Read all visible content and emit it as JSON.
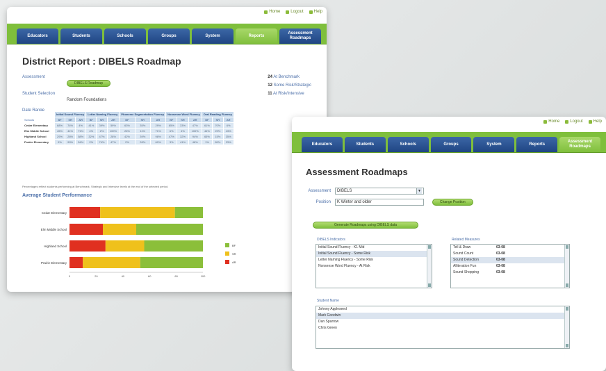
{
  "win1": {
    "toplinks": [
      "Home",
      "Logout",
      "Help"
    ],
    "tabs": [
      "Educators",
      "Students",
      "Schools",
      "Groups",
      "System",
      "Reports",
      "Assessment Roadmaps"
    ],
    "active_tab": 5,
    "title": "District Report : DIBELS Roadmap",
    "info": [
      {
        "label": "Assessment",
        "value": "DIBELS Roadmap",
        "pill": true
      },
      {
        "label": "Student Selection",
        "value": "Random Foundations",
        "pill": false
      },
      {
        "label": "Date Range",
        "value": "",
        "pill": false
      }
    ],
    "links": [
      {
        "count": "24",
        "text": "At Benchmark"
      },
      {
        "count": "12",
        "text": "Some Risk/Strategic"
      },
      {
        "count": "11",
        "text": "At Risk/Intensive"
      }
    ],
    "table": {
      "groups": [
        "Initial Sound Fluency",
        "Letter Naming Fluency",
        "Phoneme Segmentation Fluency",
        "Nonsense Word Fluency",
        "Oral Reading Fluency"
      ],
      "subheaders": [
        "BF",
        "SR",
        "AR"
      ],
      "first_col": "Schools",
      "rows": [
        {
          "name": "Cedar Elementary",
          "cells": [
            "68%",
            "74%",
            "4%",
            "41%",
            "39%",
            "59%",
            "63%",
            "35%",
            "29%",
            "65%",
            "33%",
            "47%",
            "61%",
            "70%",
            "6%"
          ]
        },
        {
          "name": "Elm Middle School",
          "cells": [
            "45%",
            "41%",
            "71%",
            "4%",
            "2%",
            "100%",
            "26%",
            "11%",
            "71%",
            "6%",
            "4%",
            "100%",
            "44%",
            "29%",
            "43%"
          ]
        },
        {
          "name": "Highland School",
          "cells": "29% 28% 58% 32% 47% 28% 42% 39% 98% 47% 32% 94% 65% 15% 35%"
        },
        {
          "name": "Prairie Elementary",
          "cells": "9% 99% 54% 2% 74% 47% 2% 28% 60% 3% 41% 48% 1% 89% 23%"
        }
      ]
    },
    "footnote": "Percentages reflect students performing at Benchmark, Strategic and Intensive levels at the end of the selected period.",
    "perf_title": "Average Student Performance"
  },
  "chart_data": {
    "type": "bar",
    "orientation": "horizontal",
    "stacked": true,
    "categories": [
      "Cedar Elementary",
      "Elm Middle School",
      "Highland School",
      "Prairie Elementary"
    ],
    "series": [
      {
        "name": "AR",
        "color": "#e03020",
        "values": [
          23,
          25,
          27,
          10
        ]
      },
      {
        "name": "SR",
        "color": "#efc11c",
        "values": [
          56,
          25,
          29,
          43
        ]
      },
      {
        "name": "BF",
        "color": "#8bbf3a",
        "values": [
          21,
          50,
          44,
          47
        ]
      }
    ],
    "legend": [
      "BF",
      "SR",
      "AR"
    ],
    "legend_position": "right",
    "xlim": [
      0,
      100
    ],
    "xticks": [
      "0",
      "20",
      "40",
      "60",
      "80",
      "100"
    ]
  },
  "win2": {
    "toplinks": [
      "Home",
      "Logout",
      "Help"
    ],
    "tabs": [
      "Educators",
      "Students",
      "Schools",
      "Groups",
      "System",
      "Reports",
      "Assessment Roadmaps"
    ],
    "active_tab": 6,
    "title": "Assessment Roadmaps",
    "assessment_label": "Assessment",
    "assessment_value": "DIBELS",
    "position_label": "Position",
    "position_value": "K Winter and older",
    "change_button": "Change Position",
    "generate_button": "Generate Roadmaps using DIBELS data",
    "indicators_label": "DIBELS Indicators",
    "indicators": [
      "Initial Sound Fluency - K1 Mid",
      "Initial Sound Fluency - Some Risk",
      "Letter Naming Fluency - Some Risk",
      "Nonsense Word Fluency - At Risk"
    ],
    "selected_indicator": 1,
    "measures_label": "Related Measures",
    "measures": [
      {
        "name": "Tell & Draw",
        "score": "03-08"
      },
      {
        "name": "Sound Count",
        "score": "03-08"
      },
      {
        "name": "Sound Detection",
        "score": "03-08"
      },
      {
        "name": "Alliteration Fun",
        "score": "03-08"
      },
      {
        "name": "Sound Shopping",
        "score": "03-08"
      }
    ],
    "selected_measure": 2,
    "students_label": "Student Name",
    "students": [
      "Johnny Appleseed",
      "Mark Goodwin",
      "Dan Sparrow",
      "Chris Green"
    ],
    "selected_student": 1
  }
}
